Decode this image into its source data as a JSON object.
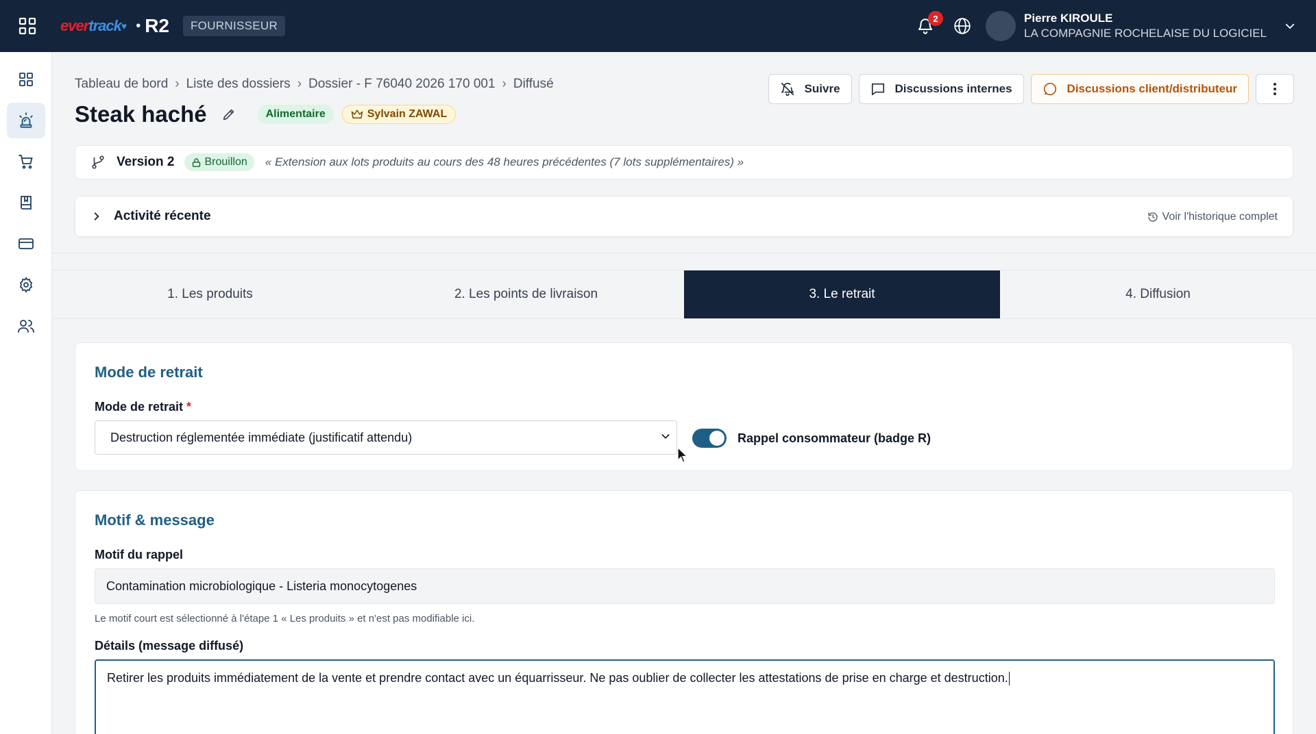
{
  "topbar": {
    "logo_part1": "ever",
    "logo_part2": "track",
    "product": "R2",
    "role": "FOURNISSEUR",
    "notifications_count": "2",
    "user_name": "Pierre KIROULE",
    "user_org": "LA COMPAGNIE ROCHELAISE DU LOGICIEL"
  },
  "breadcrumb": [
    "Tableau de bord",
    "Liste des dossiers",
    "Dossier - F 76040 2026 170 001",
    "Diffusé"
  ],
  "breadcrumb_separator": "›",
  "page": {
    "title": "Steak haché",
    "category": "Alimentaire",
    "owner": "Sylvain ZAWAL"
  },
  "actions": {
    "follow": "Suivre",
    "internal_discussions": "Discussions internes",
    "client_discussions": "Discussions client/distributeur"
  },
  "version": {
    "label": "Version 2",
    "status": "Brouillon",
    "note": "« Extension aux lots produits au cours des 48 heures précédentes (7 lots supplémentaires) »"
  },
  "activity": {
    "title": "Activité récente",
    "history_link": "Voir l'historique complet"
  },
  "tabs": [
    {
      "label": "1. Les produits",
      "active": false
    },
    {
      "label": "2. Les points de livraison",
      "active": false
    },
    {
      "label": "3. Le retrait",
      "active": true
    },
    {
      "label": "4. Diffusion",
      "active": false
    }
  ],
  "withdrawal": {
    "section_title": "Mode de retrait",
    "field_label": "Mode de retrait",
    "required_mark": "*",
    "selected_value": "Destruction réglementée immédiate (justificatif attendu)",
    "toggle_label": "Rappel consommateur (badge R)",
    "toggle_on": true
  },
  "motif": {
    "section_title": "Motif & message",
    "reason_label": "Motif du rappel",
    "reason_value": "Contamination microbiologique - Listeria monocytogenes",
    "reason_hint": "Le motif court est sélectionné à l'étape 1 « Les produits » et n'est pas modifiable ici.",
    "details_label": "Détails (message diffusé)",
    "details_value": "Retirer les produits immédiatement de la vente et prendre contact avec un équarrisseur. Ne pas oublier de collecter les attestations de prise en charge et destruction."
  },
  "colors": {
    "topbar": "#14243a",
    "accent": "#1f5f86",
    "logo_red": "#e2202f",
    "logo_blue": "#3f8ee0",
    "badge_red": "#dc2626"
  },
  "icons": {
    "apps": "grid-icon",
    "bell": "bell-icon",
    "globe": "globe-icon",
    "chevron": "chevron-down-icon"
  }
}
